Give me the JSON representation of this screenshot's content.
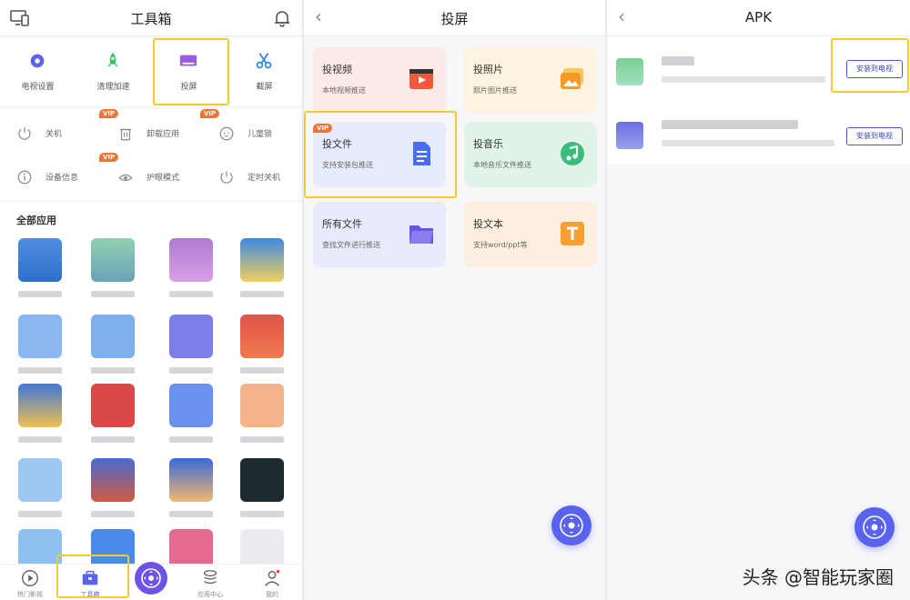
{
  "colors": {
    "accent": "#5a63ee",
    "highlight": "#f4c935",
    "vip": "#e9773a"
  },
  "toolbox": {
    "title": "工具箱",
    "tools": [
      {
        "label": "电视设置",
        "icon": "gear-icon"
      },
      {
        "label": "清理加速",
        "icon": "rocket-icon"
      },
      {
        "label": "投屏",
        "icon": "screen-cast-icon"
      },
      {
        "label": "截屏",
        "icon": "scissors-icon"
      }
    ],
    "system": [
      {
        "label": "关机",
        "icon": "power-icon"
      },
      {
        "label": "卸载应用",
        "icon": "trash-icon",
        "vip": "VIP"
      },
      {
        "label": "儿童锁",
        "icon": "child-lock-icon",
        "vip": "VIP"
      },
      {
        "label": "设备信息",
        "icon": "info-icon"
      },
      {
        "label": "护眼模式",
        "icon": "eye-care-icon",
        "vip": "VIP"
      },
      {
        "label": "定时关机",
        "icon": "timer-power-icon"
      }
    ],
    "all_apps_title": "全部应用",
    "nav": [
      {
        "label": "热门影视",
        "icon": "play-icon"
      },
      {
        "label": "工具箱",
        "icon": "toolbox-icon"
      },
      {
        "label": "",
        "icon": "remote-icon"
      },
      {
        "label": "应用中心",
        "icon": "stack-icon"
      },
      {
        "label": "我的",
        "icon": "user-icon"
      }
    ]
  },
  "cast": {
    "title": "投屏",
    "cards": [
      {
        "title": "投视频",
        "subtitle": "本地视频推送",
        "icon": "video-icon"
      },
      {
        "title": "投照片",
        "subtitle": "照片图片推送",
        "icon": "photo-icon"
      },
      {
        "title": "投文件",
        "subtitle": "支持安装包推送",
        "icon": "file-icon",
        "vip": "VIP"
      },
      {
        "title": "投音乐",
        "subtitle": "本地音乐文件推送",
        "icon": "music-icon"
      },
      {
        "title": "所有文件",
        "subtitle": "查找文件进行推送",
        "icon": "folder-icon"
      },
      {
        "title": "投文本",
        "subtitle": "支持word/ppt等",
        "icon": "text-icon"
      }
    ]
  },
  "apk": {
    "title": "APK",
    "items": [
      {
        "button": "安装到电视"
      },
      {
        "button": "安装到电视"
      }
    ]
  },
  "watermark": "头条 @智能玩家圈"
}
